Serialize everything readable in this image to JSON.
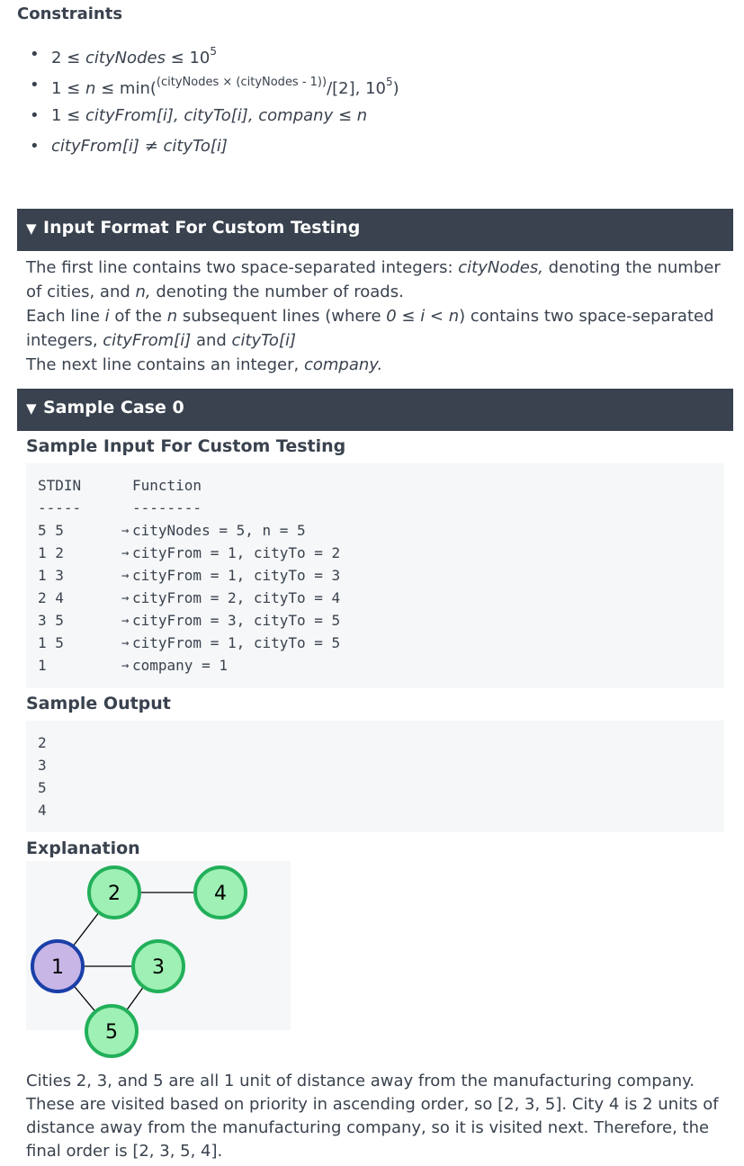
{
  "constraints": {
    "title": "Constraints",
    "items": [
      {
        "pre": "2 ≤ ",
        "var": "cityNodes",
        "post": " ≤ 10",
        "sup": "5"
      },
      {
        "pre": "1 ≤ ",
        "var": "n",
        "mid": " ≤ min(",
        "frac": "(cityNodes × (cityNodes - 1))",
        "slash": "/[2], 10",
        "sup": "5",
        "end": ")"
      },
      {
        "pre": "1 ≤ ",
        "var": "cityFrom[i], cityTo[i], company",
        "post": " ≤ ",
        "var2": "n"
      },
      {
        "var": "cityFrom[i]",
        "post": " ≠ ",
        "var2": "cityTo[i]"
      }
    ]
  },
  "input_format": {
    "title": "Input Format For Custom Testing",
    "p1_a": "The first line contains two space-separated integers: ",
    "p1_b": "cityNodes,",
    "p1_c": " denoting the number of cities, and ",
    "p1_d": "n,",
    "p1_e": " denoting the number of roads.",
    "p2_a": "Each line ",
    "p2_b": "i",
    "p2_c": " of the ",
    "p2_d": "n",
    "p2_e": " subsequent lines (where ",
    "p2_f": "0 ≤ i < n",
    "p2_g": ") contains two space-separated integers, ",
    "p2_h": "cityFrom[i]",
    "p2_i": " and ",
    "p2_j": "cityTo[i]",
    "p3_a": "The next line contains an integer, ",
    "p3_b": "company."
  },
  "sample_case": {
    "title": "Sample Case 0",
    "input_heading": "Sample Input For Custom Testing",
    "header_left": "STDIN",
    "header_right": "Function",
    "sep_left": "-----",
    "sep_right": "--------",
    "arrow": "→",
    "rows": [
      {
        "stdin": "5 5",
        "fn": "cityNodes = 5, n = 5"
      },
      {
        "stdin": "1 2",
        "fn": "cityFrom = 1, cityTo = 2"
      },
      {
        "stdin": "1 3",
        "fn": "cityFrom = 1, cityTo = 3"
      },
      {
        "stdin": "2 4",
        "fn": "cityFrom = 2, cityTo = 4"
      },
      {
        "stdin": "3 5",
        "fn": "cityFrom = 3, cityTo = 5"
      },
      {
        "stdin": "1 5",
        "fn": "cityFrom = 1, cityTo = 5"
      },
      {
        "stdin": "1",
        "fn": "company = 1"
      }
    ],
    "output_heading": "Sample Output",
    "output": [
      "2",
      "3",
      "5",
      "4"
    ],
    "explanation_heading": "Explanation",
    "explanation_text": "Cities 2, 3, and 5 are all 1 unit of distance away from the manufacturing company. These are visited based on priority in ascending order, so [2, 3, 5]. City 4 is 2 units of distance away from the manufacturing company, so it is visited next. Therefore, the final order is [2, 3, 5, 4]."
  },
  "graph": {
    "nodes": [
      {
        "id": "1",
        "fill": "#c8b6e6",
        "stroke": "#1a3fa8"
      },
      {
        "id": "2",
        "fill": "#9ef0b4",
        "stroke": "#22b05a"
      },
      {
        "id": "3",
        "fill": "#9ef0b4",
        "stroke": "#22b05a"
      },
      {
        "id": "4",
        "fill": "#9ef0b4",
        "stroke": "#22b05a"
      },
      {
        "id": "5",
        "fill": "#9ef0b4",
        "stroke": "#22b05a"
      }
    ],
    "edges": [
      [
        "1",
        "2"
      ],
      [
        "2",
        "4"
      ],
      [
        "1",
        "3"
      ],
      [
        "3",
        "5"
      ],
      [
        "1",
        "5"
      ]
    ]
  },
  "colors": {
    "header_bar": "#39424e",
    "code_bg": "#f5f7f8",
    "text": "#39424e"
  }
}
